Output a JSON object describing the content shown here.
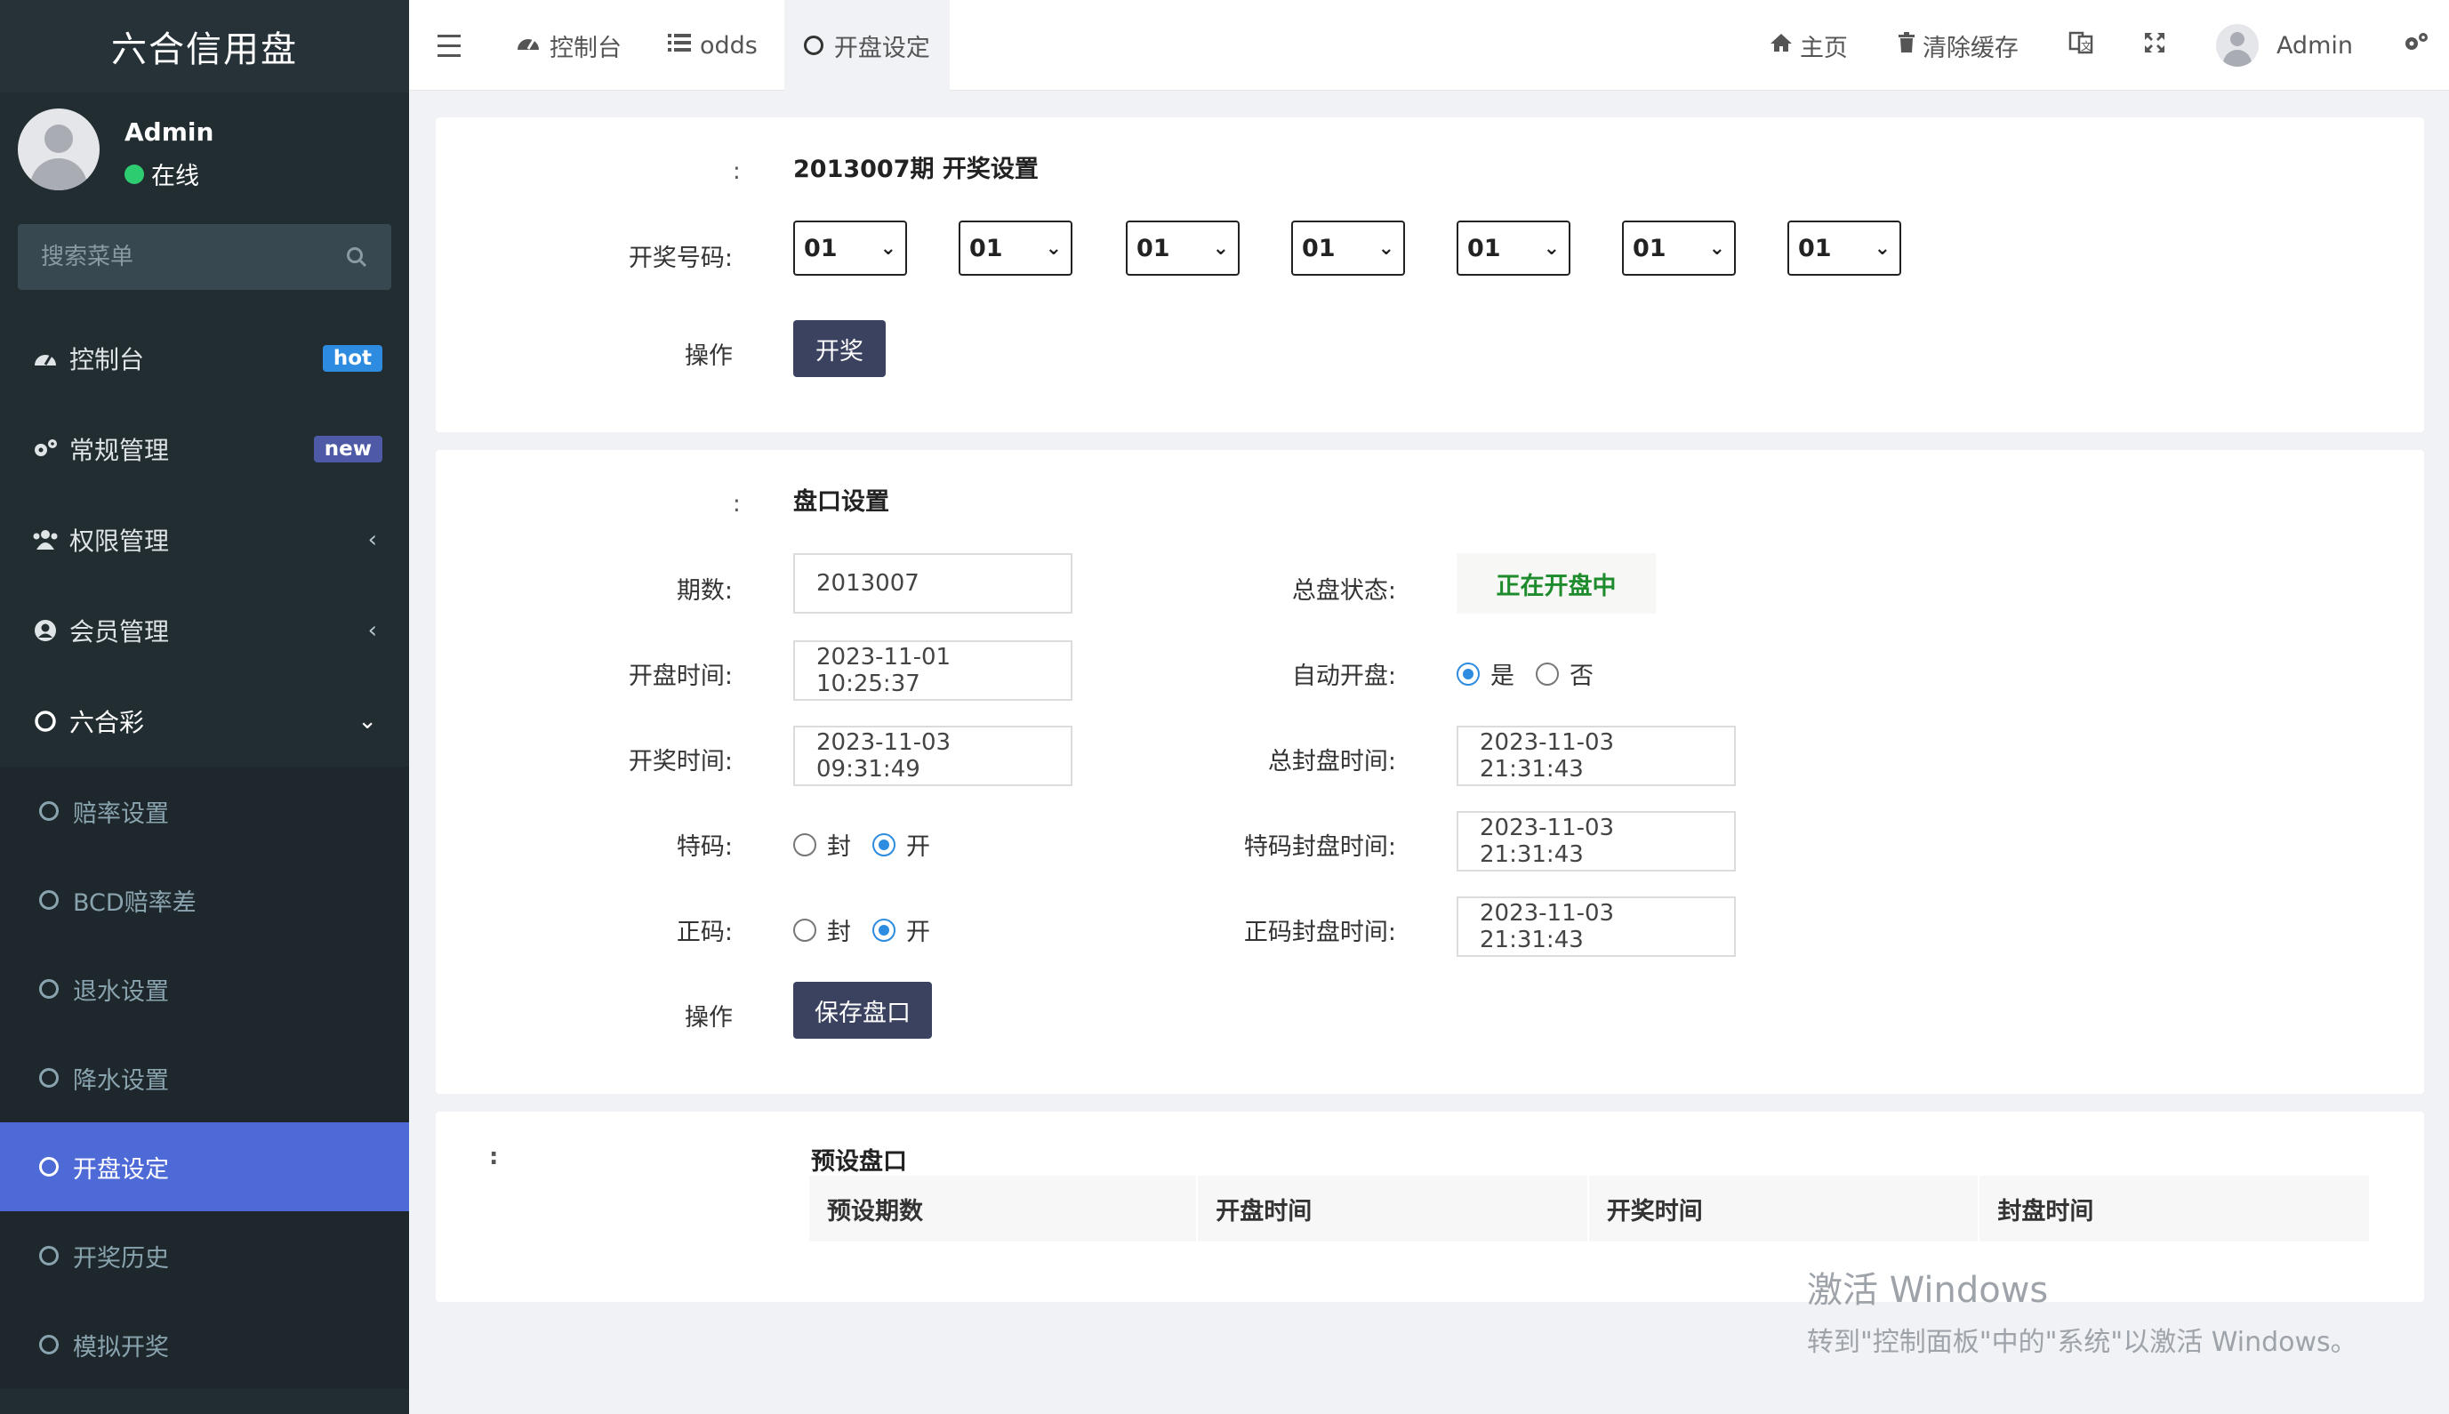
{
  "app": {
    "title": "六合信用盘"
  },
  "user": {
    "name": "Admin",
    "status": "在线"
  },
  "sidebar": {
    "search_placeholder": "搜索菜单",
    "items": [
      {
        "label": "控制台",
        "icon": "dashboard-icon",
        "badge": "hot"
      },
      {
        "label": "常规管理",
        "icon": "cogs-icon",
        "badge": "new"
      },
      {
        "label": "权限管理",
        "icon": "users-icon",
        "arrow": "‹"
      },
      {
        "label": "会员管理",
        "icon": "user-circle-icon",
        "arrow": "‹"
      },
      {
        "label": "六合彩",
        "icon": "circle-icon",
        "arrow": "⌄"
      }
    ],
    "submenu": [
      {
        "label": "赔率设置"
      },
      {
        "label": "BCD赔率差"
      },
      {
        "label": "退水设置"
      },
      {
        "label": "降水设置"
      },
      {
        "label": "开盘设定",
        "active": true
      },
      {
        "label": "开奖历史"
      },
      {
        "label": "模拟开奖"
      }
    ]
  },
  "navbar": {
    "tabs": [
      {
        "label": "控制台",
        "icon": "dashboard-icon"
      },
      {
        "label": "odds",
        "icon": "list-icon"
      },
      {
        "label": "开盘设定",
        "icon": "circle-icon",
        "active": true
      }
    ],
    "right": {
      "home": "主页",
      "clear_cache": "清除缓存",
      "username": "Admin"
    }
  },
  "draw_panel": {
    "colon": ":",
    "title": "2013007期 开奖设置",
    "numbers_label": "开奖号码:",
    "numbers": [
      "01",
      "01",
      "01",
      "01",
      "01",
      "01",
      "01"
    ],
    "action_label": "操作",
    "draw_button": "开奖"
  },
  "market_panel": {
    "colon": ":",
    "title": "盘口设置",
    "period_label": "期数:",
    "period_value": "2013007",
    "open_time_label": "开盘时间:",
    "open_time_value": "2023-11-01 10:25:37",
    "draw_time_label": "开奖时间:",
    "draw_time_value": "2023-11-03 09:31:49",
    "special_label": "特码:",
    "normal_label": "正码:",
    "closed_label": "封",
    "open_label": "开",
    "action_label": "操作",
    "save_button": "保存盘口",
    "status_label": "总盘状态:",
    "status_value": "正在开盘中",
    "auto_open_label": "自动开盘:",
    "yes_label": "是",
    "no_label": "否",
    "total_close_label": "总封盘时间:",
    "total_close_value": "2023-11-03 21:31:43",
    "special_close_label": "特码封盘时间:",
    "special_close_value": "2023-11-03 21:31:43",
    "normal_close_label": "正码封盘时间:",
    "normal_close_value": "2023-11-03 21:31:43"
  },
  "preset_panel": {
    "colon": ":",
    "title": "预设盘口",
    "columns": [
      "预设期数",
      "开盘时间",
      "开奖时间",
      "封盘时间"
    ]
  },
  "watermark": {
    "line1": "激活 Windows",
    "line2": "转到\"控制面板\"中的\"系统\"以激活 Windows。"
  },
  "colors": {
    "sidebar_bg": "#222d32",
    "active_menu": "#4e6ad6",
    "button": "#3a4260",
    "status_green": "#1e8c2d",
    "radio_blue": "#2d8ce0"
  }
}
